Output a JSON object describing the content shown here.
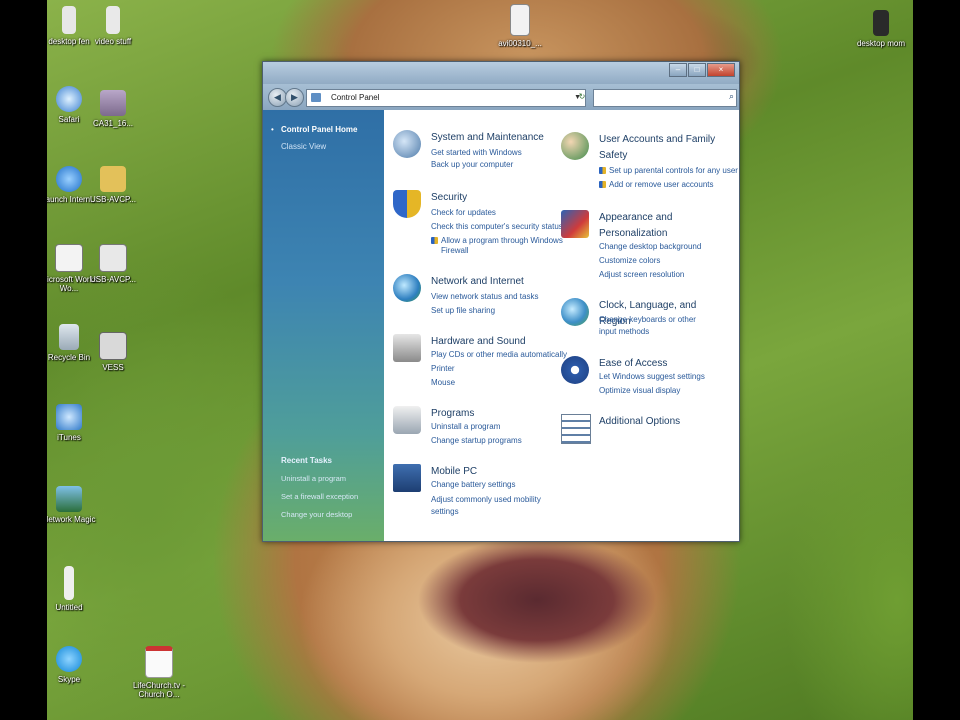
{
  "desktop_icons": [
    {
      "label": "desktop fen",
      "x": 0,
      "y": 0
    },
    {
      "label": "video stuff"
    },
    {
      "label": "avi00310_..."
    },
    {
      "label": "desktop mom"
    },
    {
      "label": "Safari"
    },
    {
      "label": "CA31_16..."
    },
    {
      "label": "Launch Intern..."
    },
    {
      "label": "USB-AVCP..."
    },
    {
      "label": "Microsoft Works Wo..."
    },
    {
      "label": "USB-AVCP..."
    },
    {
      "label": "Recycle Bin"
    },
    {
      "label": "VESS"
    },
    {
      "label": "iTunes"
    },
    {
      "label": "Network Magic"
    },
    {
      "label": "Untitled"
    },
    {
      "label": "Skype"
    },
    {
      "label": "LifeChurch.tv - Church O..."
    }
  ],
  "window": {
    "address": "Control Panel",
    "search_placeholder": "",
    "nav": {
      "home": "Control Panel Home",
      "classic": "Classic View",
      "recent_title": "Recent Tasks",
      "recent": [
        "Uninstall a program",
        "Set a firewall exception",
        "Change your desktop"
      ]
    },
    "categories_left": [
      {
        "title": "System and Maintenance",
        "links": [
          "Get started with Windows",
          "Back up your computer"
        ]
      },
      {
        "title": "Security",
        "links": [
          "Check for updates",
          "Check this computer's security status",
          "Allow a program through Windows Firewall"
        ]
      },
      {
        "title": "Network and Internet",
        "links": [
          "View network status and tasks",
          "Set up file sharing"
        ]
      },
      {
        "title": "Hardware and Sound",
        "links": [
          "Play CDs or other media automatically",
          "Printer",
          "Mouse"
        ]
      },
      {
        "title": "Programs",
        "links": [
          "Uninstall a program",
          "Change startup programs"
        ]
      },
      {
        "title": "Mobile PC",
        "links": [
          "Change battery settings",
          "Adjust commonly used mobility settings"
        ]
      }
    ],
    "categories_right": [
      {
        "title": "User Accounts and Family Safety",
        "links": [
          "Set up parental controls for any user",
          "Add or remove user accounts"
        ]
      },
      {
        "title": "Appearance and Personalization",
        "links": [
          "Change desktop background",
          "Customize colors",
          "Adjust screen resolution"
        ]
      },
      {
        "title": "Clock, Language, and Region",
        "links": [
          "Change keyboards or other input methods"
        ]
      },
      {
        "title": "Ease of Access",
        "links": [
          "Let Windows suggest settings",
          "Optimize visual display"
        ]
      },
      {
        "title": "Additional Options",
        "links": []
      }
    ]
  },
  "colors": {
    "accent": "#2a5a9a",
    "nav_top": "#2f6fa6",
    "nav_bottom": "#6aae6a"
  }
}
